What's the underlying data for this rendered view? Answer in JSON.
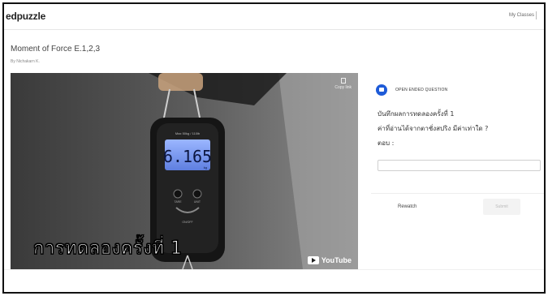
{
  "header": {
    "logo": "edpuzzle",
    "my_classes": "My Classes"
  },
  "video": {
    "title": "Moment of Force E.1,2,3",
    "byline": "By Nichakarn K.",
    "copy_link_label": "Copy link",
    "scale_reading": "6.165",
    "scale_brand": "Max 50kg / 110lb",
    "scale_unit_right": "kg",
    "scale_button_left": "TARE",
    "scale_button_right": "UNIT",
    "scale_onoff": "ON/OFF",
    "caption": "การทดลองครั้งที่ 1",
    "youtube_label": "YouTube"
  },
  "question": {
    "type_label": "OPEN ENDED QUESTION",
    "line1": "บันทึกผลการทดลองครั้งที่ 1",
    "line2": "ค่าที่อ่านได้จากตาชั่งสปริง มีค่าเท่าใด ?",
    "line3": "ตอบ :",
    "answer_value": "",
    "answer_placeholder": ""
  },
  "actions": {
    "rewatch": "Rewatch",
    "submit": "Submit"
  }
}
